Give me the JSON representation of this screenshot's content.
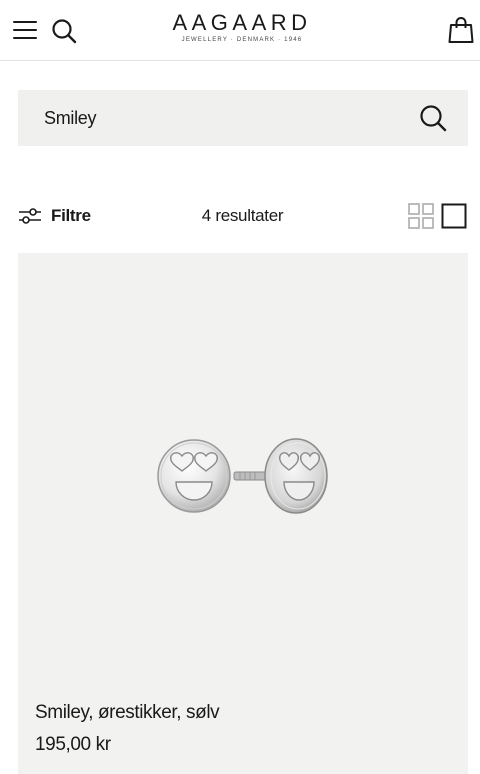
{
  "header": {
    "menu_icon": "hamburger-menu-icon",
    "search_icon": "search-icon",
    "logo_text": "AAGAARD",
    "logo_tagline": "JEWELLERY · DENMARK · 1946",
    "bag_icon": "shopping-bag-icon"
  },
  "search": {
    "value": "Smiley",
    "button_icon": "search-icon"
  },
  "toolbar": {
    "filter_label": "Filtre",
    "filter_icon": "sliders-icon",
    "result_count": "4 resultater",
    "grid_small_icon": "grid-four-icon",
    "grid_large_icon": "grid-single-icon"
  },
  "products": [
    {
      "name": "Smiley, ørestikker, sølv",
      "price": "195,00 kr",
      "image_icon": "smiley-heart-eyes-earrings"
    }
  ],
  "colors": {
    "text": "#1a1a1a",
    "search_bg": "#f0f0ef",
    "card_bg": "#f2f2f1",
    "icon_inactive": "#b5b5b5",
    "border": "#e2e2e2"
  }
}
